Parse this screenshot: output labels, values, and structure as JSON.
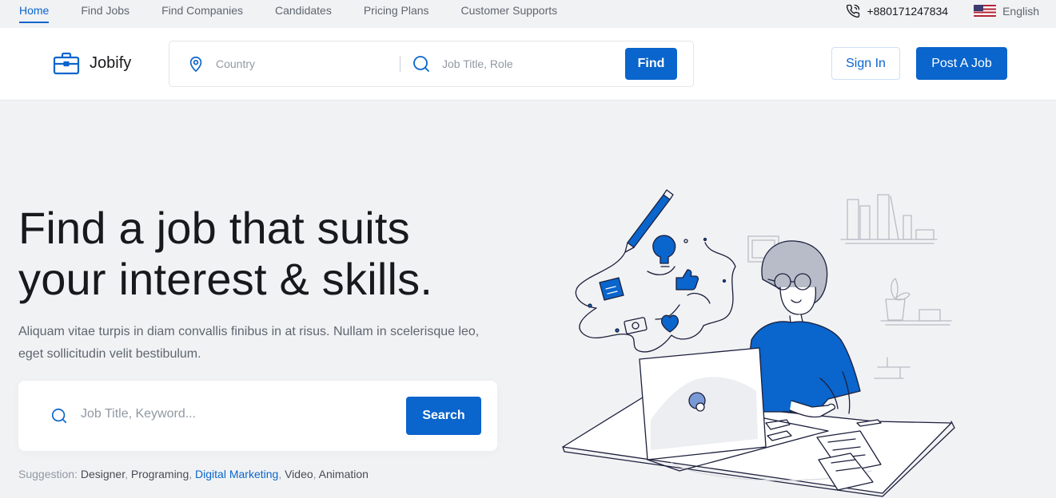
{
  "topnav": {
    "links": [
      "Home",
      "Find Jobs",
      "Find Companies",
      "Candidates",
      "Pricing Plans",
      "Customer Supports"
    ],
    "phone": "+880171247834",
    "language": "English"
  },
  "header": {
    "logo_text": "Jobify",
    "country_placeholder": "Country",
    "job_placeholder": "Job Title, Role",
    "find_label": "Find",
    "signin_label": "Sign In",
    "post_job_label": "Post A Job"
  },
  "hero": {
    "title_line1": "Find a job that suits",
    "title_line2": "your interest & skills.",
    "subtitle": "Aliquam vitae turpis in diam convallis finibus in at risus. Nullam in scelerisque leo, eget sollicitudin velit bestibulum.",
    "search_placeholder": "Job Title, Keyword...",
    "search_label": "Search",
    "suggestion_label": "Suggestion:",
    "suggestions": [
      "Designer",
      "Programing",
      "Digital Marketing",
      "Video",
      "Animation"
    ]
  },
  "colors": {
    "accent": "#0a65cc",
    "text": "#18191c",
    "muted": "#5e6670"
  },
  "icons": [
    "phone-icon",
    "us-flag-icon",
    "briefcase-logo-icon",
    "map-pin-icon",
    "search-icon"
  ]
}
